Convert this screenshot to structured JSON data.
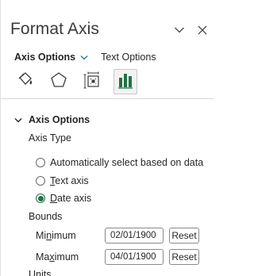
{
  "pane": {
    "title": "Format Axis",
    "options_icon": "chevron-down-icon",
    "close_icon": "close-icon"
  },
  "tabs": {
    "axis_options": "Axis Options",
    "text_options": "Text Options"
  },
  "category_icons": [
    "fill-line-icon",
    "effects-pentagon-icon",
    "size-properties-icon",
    "axis-options-bar-chart-icon"
  ],
  "section": {
    "title": "Axis Options",
    "axis_type_label": "Axis Type",
    "radios": [
      {
        "label": "Automatically select based on data",
        "checked": false
      },
      {
        "label_pre": "",
        "label_key": "T",
        "label_post": "ext axis",
        "checked": false
      },
      {
        "label_pre": "",
        "label_key": "D",
        "label_post": "ate axis",
        "checked": true
      }
    ],
    "bounds_label": "Bounds",
    "minimum": {
      "label_pre": "Mi",
      "label_key": "n",
      "label_post": "imum",
      "value": "02/01/1900",
      "reset": "Reset"
    },
    "maximum": {
      "label_pre": "Ma",
      "label_key": "x",
      "label_post": "imum",
      "value": "04/01/1900",
      "reset": "Reset"
    },
    "units_label": "Units"
  },
  "colors": {
    "accent": "#217346"
  }
}
